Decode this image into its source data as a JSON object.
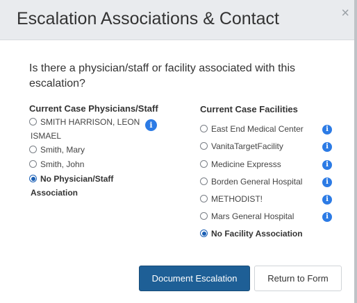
{
  "dialog": {
    "title": "Escalation Associations & Contact",
    "close_symbol": "×",
    "question": "Is there a physician/staff or facility associated with this escalation?"
  },
  "physicians": {
    "heading": "Current Case Physicians/Staff",
    "options": [
      {
        "label": "SMITH HARRISON, LEON",
        "label_line2": "ISMAEL",
        "checked": false,
        "info": true
      },
      {
        "label": "Smith, Mary",
        "checked": false,
        "info": false
      },
      {
        "label": "Smith, John",
        "checked": false,
        "info": false
      },
      {
        "label": "No Physician/Staff",
        "label_line2": "Association",
        "checked": true,
        "info": false
      }
    ]
  },
  "facilities": {
    "heading": "Current Case Facilities",
    "options": [
      {
        "label": "East End Medical Center",
        "checked": false,
        "info": true
      },
      {
        "label": "VanitaTargetFacility",
        "checked": false,
        "info": true
      },
      {
        "label": "Medicine Expresss",
        "checked": false,
        "info": true
      },
      {
        "label": "Borden General Hospital",
        "checked": false,
        "info": true
      },
      {
        "label": "METHODIST!",
        "checked": false,
        "info": true
      },
      {
        "label": "Mars General Hospital",
        "checked": false,
        "info": true
      },
      {
        "label": "No Facility Association",
        "checked": true,
        "info": false
      }
    ]
  },
  "buttons": {
    "primary": "Document Escalation",
    "secondary": "Return to Form"
  },
  "info_symbol": "i",
  "colors": {
    "primary_button": "#1e5f96",
    "info_icon": "#2c7be5",
    "header_bg": "#e9ebee"
  }
}
